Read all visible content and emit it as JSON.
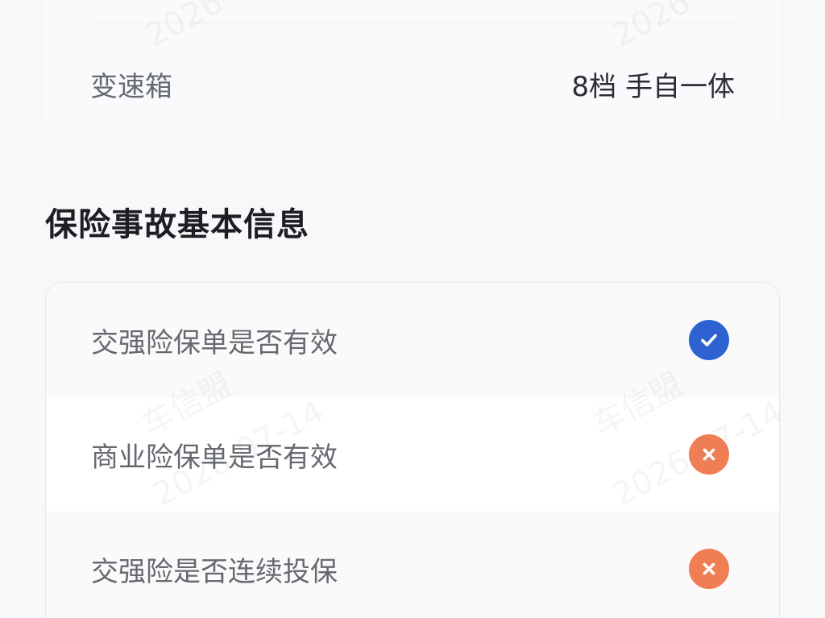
{
  "vehicle_spec": {
    "label": "变速箱",
    "value": "8档 手自一体"
  },
  "section": {
    "title": "保险事故基本信息"
  },
  "insurance": {
    "items": [
      {
        "label": "交强险保单是否有效",
        "status": "yes",
        "status_icon": "check-circle-icon",
        "color": "#2e62d1"
      },
      {
        "label": "商业险保单是否有效",
        "status": "no",
        "status_icon": "x-circle-icon",
        "color": "#f07e55"
      },
      {
        "label": "交强险是否连续投保",
        "status": "no",
        "status_icon": "x-circle-icon",
        "color": "#f07e55"
      }
    ]
  },
  "watermark": {
    "brand": "车信盟",
    "date": "2026-07-14"
  }
}
